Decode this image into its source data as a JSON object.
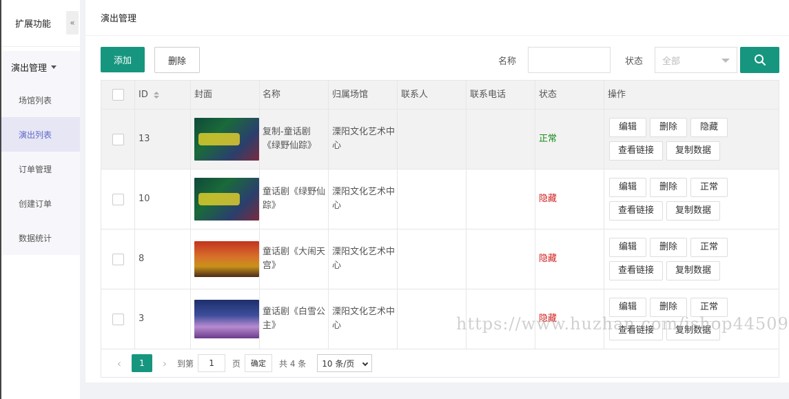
{
  "sidebar": {
    "header": "扩展功能",
    "collapse_glyph": "«",
    "group_title": "演出管理",
    "items": [
      {
        "label": "场馆列表",
        "active": false
      },
      {
        "label": "演出列表",
        "active": true
      },
      {
        "label": "订单管理",
        "active": false
      },
      {
        "label": "创建订单",
        "active": false
      },
      {
        "label": "数据统计",
        "active": false
      }
    ]
  },
  "page": {
    "title": "演出管理"
  },
  "toolbar": {
    "add_label": "添加",
    "delete_label": "删除",
    "name_label": "名称",
    "name_value": "",
    "status_label": "状态",
    "status_value": "全部"
  },
  "table": {
    "headers": [
      "",
      "ID",
      "封面",
      "名称",
      "归属场馆",
      "联系人",
      "联系电话",
      "状态",
      "操作"
    ],
    "rows": [
      {
        "id": "13",
        "cover": "green",
        "name": "复制-童话剧《绿野仙踪》",
        "venue": "溧阳文化艺术中心",
        "contact": "",
        "phone": "",
        "status": "正常",
        "status_kind": "ok",
        "ops": [
          "编辑",
          "删除",
          "隐藏"
        ],
        "ops2": [
          "查看链接",
          "复制数据"
        ],
        "highlight": true
      },
      {
        "id": "10",
        "cover": "green",
        "name": "童话剧《绿野仙踪》",
        "venue": "溧阳文化艺术中心",
        "contact": "",
        "phone": "",
        "status": "隐藏",
        "status_kind": "hide",
        "ops": [
          "编辑",
          "删除",
          "正常"
        ],
        "ops2": [
          "查看链接",
          "复制数据"
        ],
        "highlight": false
      },
      {
        "id": "8",
        "cover": "red",
        "name": "童话剧《大闹天宫》",
        "venue": "溧阳文化艺术中心",
        "contact": "",
        "phone": "",
        "status": "隐藏",
        "status_kind": "hide",
        "ops": [
          "编辑",
          "删除",
          "正常"
        ],
        "ops2": [
          "查看链接",
          "复制数据"
        ],
        "highlight": false
      },
      {
        "id": "3",
        "cover": "blue",
        "name": "童话剧《白雪公主》",
        "venue": "溧阳文化艺术中心",
        "contact": "",
        "phone": "",
        "status": "隐藏",
        "status_kind": "hide",
        "ops": [
          "编辑",
          "删除",
          "正常"
        ],
        "ops2": [
          "查看链接",
          "复制数据"
        ],
        "highlight": false
      }
    ]
  },
  "pagination": {
    "prev": "‹",
    "current": "1",
    "next": "›",
    "goto_label": "到第",
    "goto_value": "1",
    "page_unit": "页",
    "confirm": "确定",
    "total": "共 4 条",
    "page_size": "10 条/页"
  },
  "watermark": "https://www.huzhan.com/ishop44509",
  "colors": {
    "primary": "#16967f",
    "status_ok": "#1a8a1a",
    "status_hide": "#d02020",
    "active_menu": "#5f68c8"
  }
}
